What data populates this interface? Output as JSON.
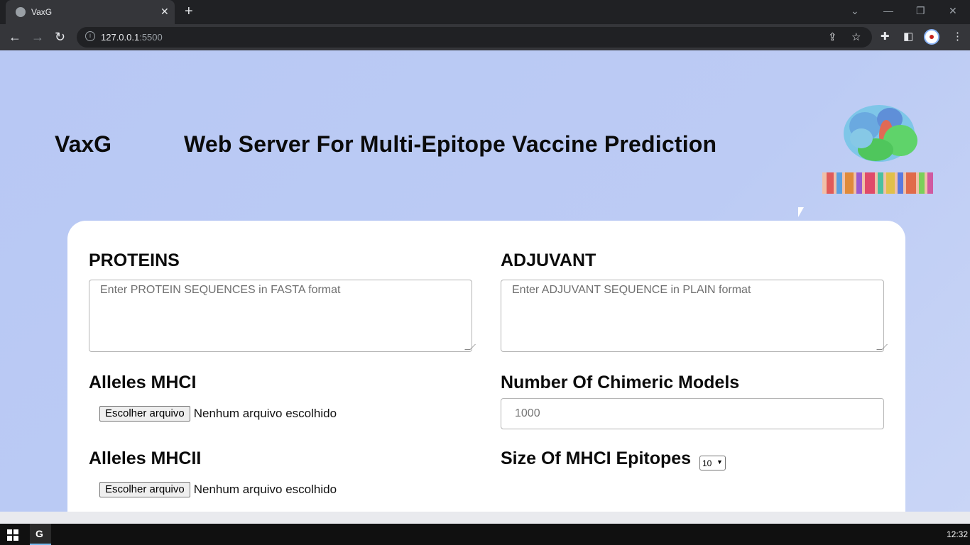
{
  "browser": {
    "tab_title": "VaxG",
    "url_host": "127.0.0.1",
    "url_port": ":5500",
    "icons": [
      "globe-icon",
      "close-icon",
      "plus-icon",
      "back-icon",
      "forward-icon",
      "reload-icon",
      "info-icon",
      "share-icon",
      "star-icon",
      "extensions-icon",
      "sidebar-icon",
      "profile-icon",
      "menu-icon"
    ]
  },
  "page": {
    "brand": "VaxG",
    "headline": "Web Server For Multi-Epitope Vaccine Prediction",
    "proteins_label": "PROTEINS",
    "proteins_placeholder": "Enter PROTEIN SEQUENCES in FASTA format",
    "adjuvant_label": "ADJUVANT",
    "adjuvant_placeholder": "Enter ADJUVANT SEQUENCE in PLAIN format",
    "mhci_label": "Alleles MHCI",
    "mhcii_label": "Alleles MHCII",
    "file_button": "Escolher arquivo",
    "file_status": "Nenhum arquivo escolhido",
    "models_label": "Number Of Chimeric Models",
    "models_placeholder": "1000",
    "mhci_size_label": "Size Of MHCI Epitopes",
    "mhci_size_value": "10"
  },
  "taskbar": {
    "clock": "12:32",
    "app_letter": "G"
  },
  "colors": {
    "page_background": "#b8c8f4",
    "card_background": "#ffffff",
    "chrome_dark": "#202124",
    "chrome_toolbar": "#35363a"
  }
}
